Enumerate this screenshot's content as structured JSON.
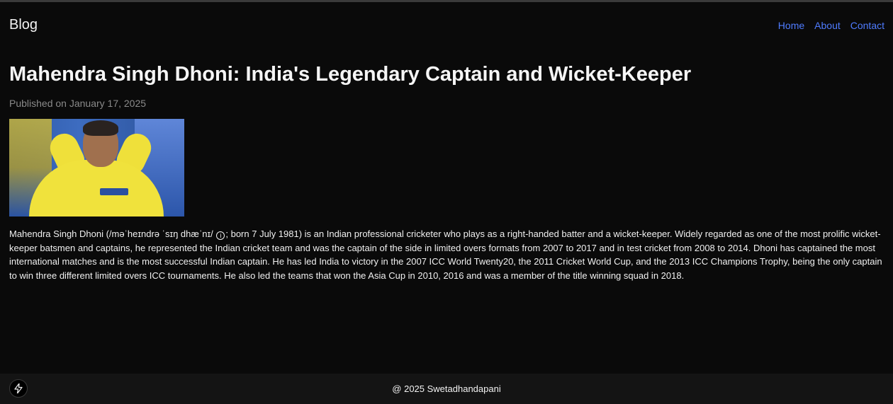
{
  "header": {
    "brand": "Blog",
    "nav": [
      {
        "label": "Home"
      },
      {
        "label": "About"
      },
      {
        "label": "Contact"
      }
    ]
  },
  "post": {
    "title": "Mahendra Singh Dhoni: India's Legendary Captain and Wicket-Keeper",
    "published": "Published on January 17, 2025",
    "body_before_icon": "Mahendra Singh Dhoni (/məˈheɪndrə ˈsɪŋ dhæˈnɪ/ ",
    "body_icon": "i",
    "body_after_icon": "; born 7 July 1981) is an Indian professional cricketer who plays as a right-handed batter and a wicket-keeper. Widely regarded as one of the most prolific wicket-keeper batsmen and captains, he represented the Indian cricket team and was the captain of the side in limited overs formats from 2007 to 2017 and in test cricket from 2008 to 2014. Dhoni has captained the most international matches and is the most successful Indian captain. He has led India to victory in the 2007 ICC World Twenty20, the 2011 Cricket World Cup, and the 2013 ICC Champions Trophy, being the only captain to win three different limited overs ICC tournaments. He also led the teams that won the Asia Cup in 2010, 2016 and was a member of the title winning squad in 2018."
  },
  "footer": {
    "copyright": "@ 2025 Swetadhandapani",
    "dev_indicator_icon": "lightning-bolt-icon"
  },
  "colors": {
    "background": "#0a0a0a",
    "link": "#4f7cff",
    "footer_bg": "#141414",
    "muted": "#8a8a8a"
  }
}
